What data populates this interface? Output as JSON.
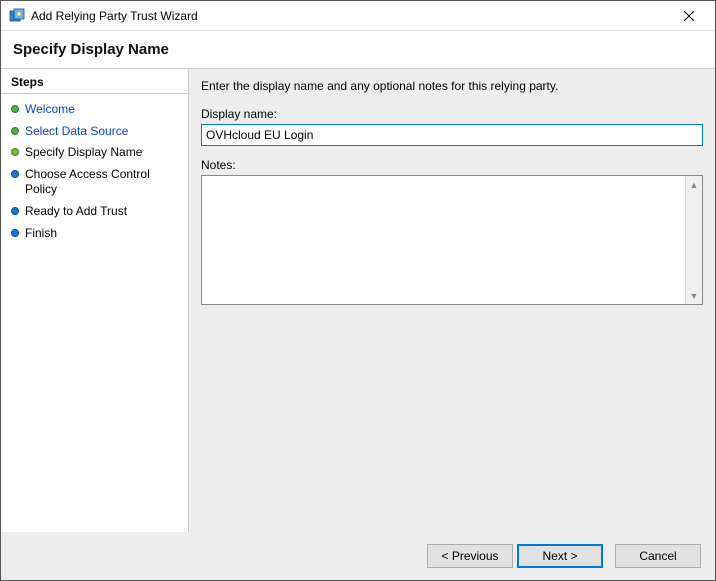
{
  "window": {
    "title": "Add Relying Party Trust Wizard"
  },
  "header": {
    "title": "Specify Display Name"
  },
  "sidebar": {
    "title": "Steps",
    "items": [
      {
        "label": "Welcome",
        "state": "done"
      },
      {
        "label": "Select Data Source",
        "state": "done"
      },
      {
        "label": "Specify Display Name",
        "state": "current"
      },
      {
        "label": "Choose Access Control Policy",
        "state": "pending"
      },
      {
        "label": "Ready to Add Trust",
        "state": "pending"
      },
      {
        "label": "Finish",
        "state": "pending"
      }
    ]
  },
  "content": {
    "instruction": "Enter the display name and any optional notes for this relying party.",
    "display_name_label": "Display name:",
    "display_name_value": "OVHcloud EU Login",
    "notes_label": "Notes:",
    "notes_value": ""
  },
  "footer": {
    "previous": "< Previous",
    "next": "Next >",
    "cancel": "Cancel"
  }
}
